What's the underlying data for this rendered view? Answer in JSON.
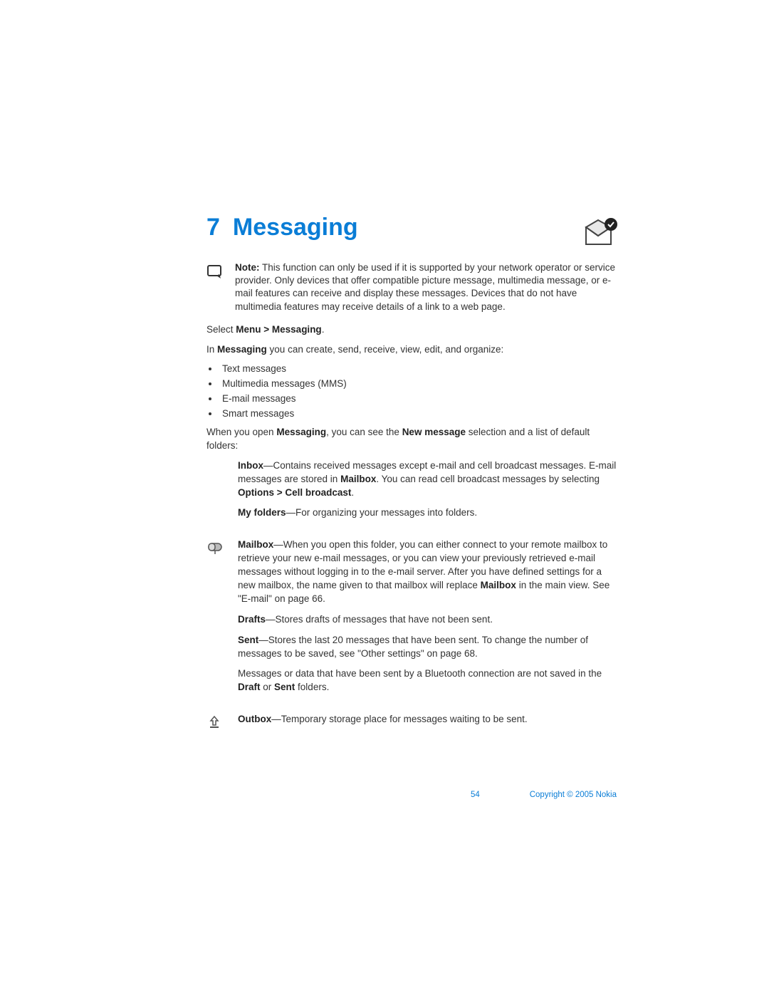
{
  "chapter": {
    "number": "7",
    "title": "Messaging"
  },
  "note": {
    "label": "Note:",
    "text": " This function can only be used if it is supported by your network operator or service provider. Only devices that offer compatible picture message, multimedia message, or e-mail features can receive and display these messages. Devices that do not have multimedia features may receive details of a link to a web page."
  },
  "select_line": {
    "pre": "Select ",
    "bold": "Menu > Messaging",
    "post": "."
  },
  "intro_line": {
    "pre": "In ",
    "bold": "Messaging",
    "post": " you can create, send, receive, view, edit, and organize:"
  },
  "bullets": [
    "Text messages",
    "Multimedia messages (MMS)",
    "E-mail messages",
    "Smart messages"
  ],
  "open_line": {
    "pre": "When you open ",
    "b1": "Messaging",
    "mid": ", you can see the ",
    "b2": "New message",
    "post": " selection and a list of default folders:"
  },
  "inbox": {
    "name": "Inbox",
    "t1": "—Contains received messages except e-mail and cell broadcast messages. E-mail messages are stored in ",
    "b1": "Mailbox",
    "t2": ". You can read cell broadcast messages by selecting ",
    "b2": "Options > Cell broadcast",
    "t3": "."
  },
  "myfolders": {
    "name": "My folders",
    "text": "—For organizing your messages into folders."
  },
  "mailbox": {
    "name": "Mailbox",
    "t1": "—When you open this folder, you can either connect to your remote mailbox to retrieve your new e-mail messages, or you can view your previously retrieved e-mail messages without logging in to the e-mail server. After you have defined settings for a new mailbox, the name given to that mailbox will replace ",
    "b1": "Mailbox",
    "t2": " in the main view. See \"E-mail\" on page 66."
  },
  "drafts": {
    "name": "Drafts",
    "text": "—Stores drafts of messages that have not been sent."
  },
  "sent": {
    "name": "Sent",
    "t1": "—Stores the last 20 messages that have been sent. To change the number of messages to be saved, see \"Other settings\" on page 68.",
    "extra_pre": "Messages or data that have been sent by a Bluetooth connection are not saved in the ",
    "eb1": "Draft",
    "emid": " or ",
    "eb2": "Sent",
    "epost": " folders."
  },
  "outbox": {
    "name": "Outbox",
    "text": "—Temporary storage place for messages waiting to be sent."
  },
  "footer": {
    "page": "54",
    "copyright": "Copyright © 2005 Nokia"
  }
}
